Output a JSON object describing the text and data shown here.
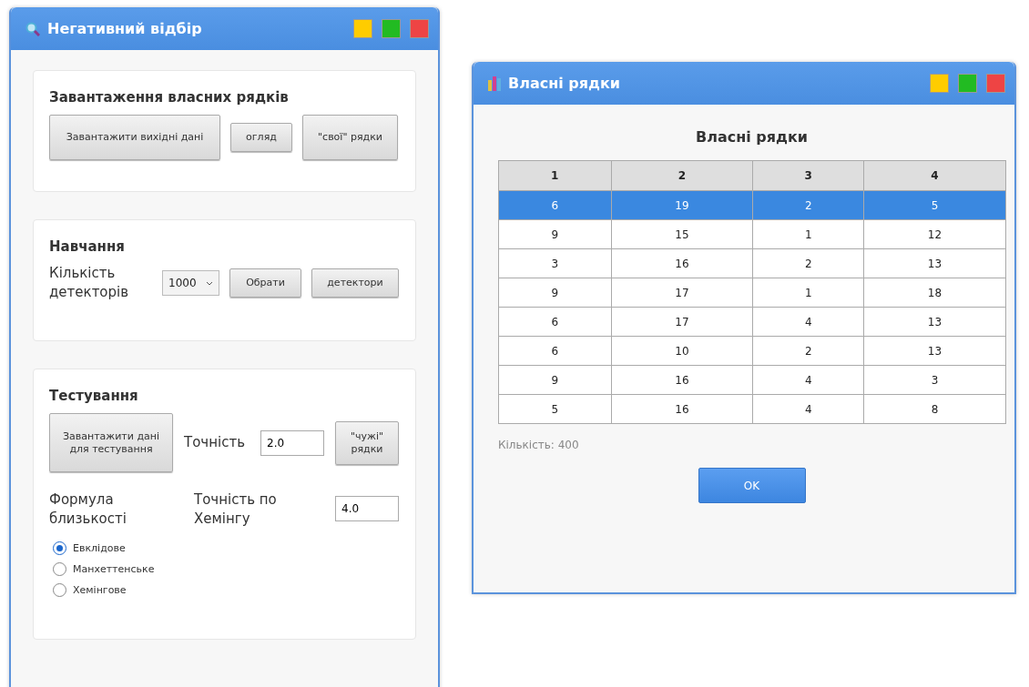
{
  "main_window": {
    "title": "Негативний відбір",
    "upload_section": {
      "title": "Завантаження власних рядків",
      "buttons": [
        "Завантажити вихідні дані",
        "огляд",
        "\"свої\" рядки"
      ]
    },
    "training_section": {
      "title": "Навчання",
      "detector_count_label": "Кількість детекторів",
      "detector_count": "1000",
      "buttons": [
        "Обрати",
        "детектори"
      ]
    },
    "testing_section": {
      "title": "Тестування",
      "load_button": "Завантажити дані для тестування",
      "accuracy_label": "Точність",
      "accuracy_value": "2.0",
      "foreign_button": "\"чужі\" рядки",
      "formula_label": "Формула близькості",
      "hamming_label": "Точність по Хемінгу",
      "hamming_value": "4.0",
      "formulas": [
        {
          "label": "Евклідове",
          "selected": true
        },
        {
          "label": "Манхеттенське",
          "selected": false
        },
        {
          "label": "Хемінгове",
          "selected": false
        }
      ]
    }
  },
  "dialog": {
    "title": "Власні рядки",
    "heading": "Власні рядки",
    "table": {
      "columns": [
        "1",
        "2",
        "3",
        "4"
      ],
      "rows": [
        {
          "cells": [
            "6",
            "19",
            "2",
            "5"
          ],
          "selected": true
        },
        {
          "cells": [
            "9",
            "15",
            "1",
            "12"
          ],
          "selected": false
        },
        {
          "cells": [
            "3",
            "16",
            "2",
            "13"
          ],
          "selected": false
        },
        {
          "cells": [
            "9",
            "17",
            "1",
            "18"
          ],
          "selected": false
        },
        {
          "cells": [
            "6",
            "17",
            "4",
            "13"
          ],
          "selected": false
        },
        {
          "cells": [
            "6",
            "10",
            "2",
            "13"
          ],
          "selected": false
        },
        {
          "cells": [
            "9",
            "16",
            "4",
            "3"
          ],
          "selected": false
        },
        {
          "cells": [
            "5",
            "16",
            "4",
            "8"
          ],
          "selected": false
        }
      ]
    },
    "count": "Кількість: 400",
    "ok_button": "OK"
  }
}
